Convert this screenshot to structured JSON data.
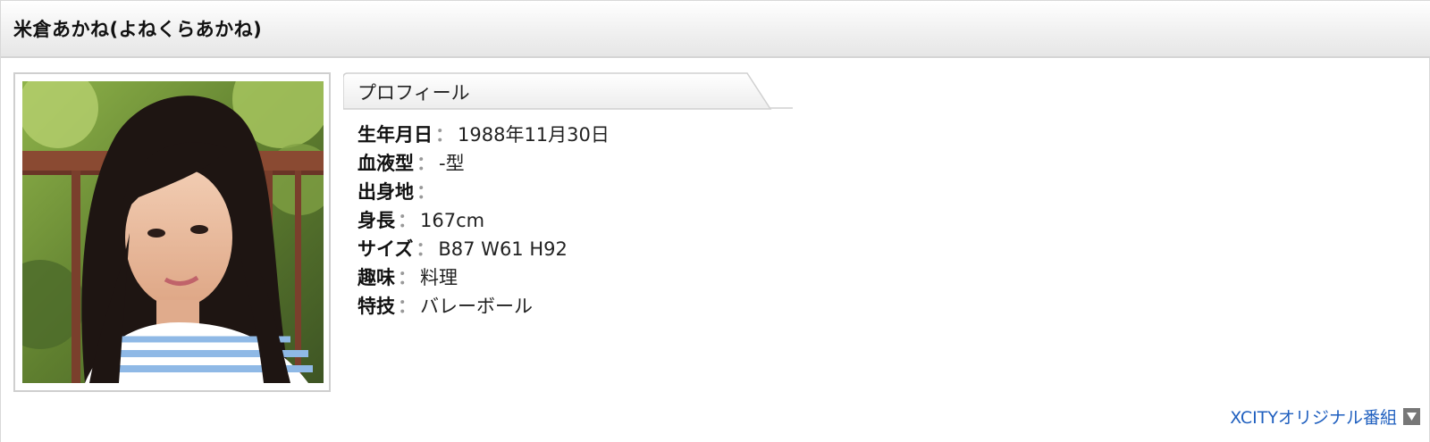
{
  "header": {
    "title": "米倉あかね(よねくらあかね)"
  },
  "photo": {
    "alt": "portrait photo"
  },
  "profile_tab": {
    "label": "プロフィール"
  },
  "profile": {
    "rows": [
      {
        "key": "生年月日",
        "sep": "：",
        "value": "1988年11月30日"
      },
      {
        "key": "血液型",
        "sep": "：",
        "value": "-型"
      },
      {
        "key": "出身地",
        "sep": "：",
        "value": ""
      },
      {
        "key": "身長",
        "sep": "：",
        "value": "167cm"
      },
      {
        "key": "サイズ",
        "sep": "：",
        "value": "B87 W61 H92"
      },
      {
        "key": "趣味",
        "sep": "：",
        "value": "料理"
      },
      {
        "key": "特技",
        "sep": "：",
        "value": "バレーボール"
      }
    ]
  },
  "footer": {
    "link_label": "XCITYオリジナル番組",
    "icon": "triangle-down-icon"
  },
  "colors": {
    "link": "#1f5fbf",
    "border": "#cfcfcf"
  }
}
